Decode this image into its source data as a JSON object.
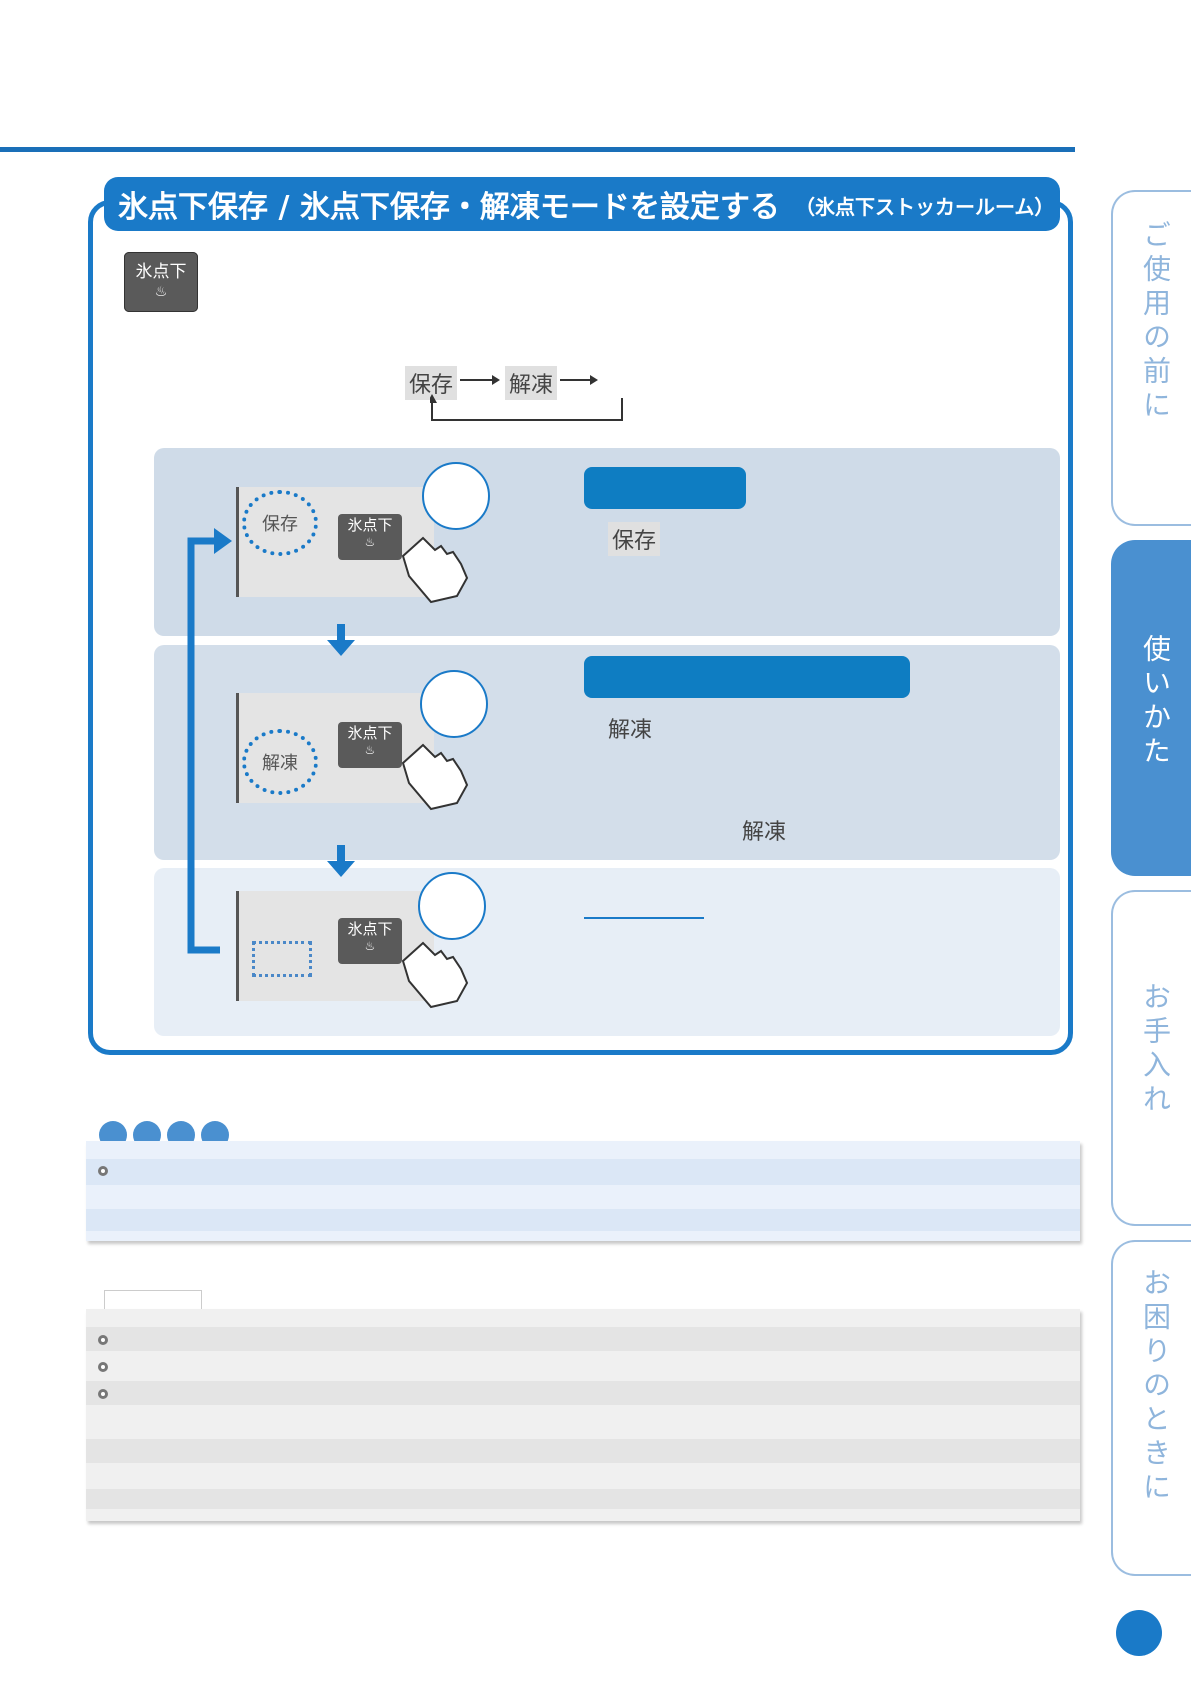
{
  "title": {
    "main": "氷点下保存 / 氷点下保存・解凍モードを設定する",
    "sub": "（氷点下ストッカールーム）"
  },
  "button": {
    "label": "氷点下",
    "fish_glyph": "♨"
  },
  "cycle": {
    "save": "保存",
    "thaw": "解凍",
    "arrow": "→"
  },
  "steps": [
    {
      "ring_label": "保存",
      "desc_label": "保存"
    },
    {
      "ring_label": "解凍",
      "desc_label": "解凍",
      "desc_label_2": "解凍"
    },
    {
      "ring_label": ""
    }
  ],
  "side_tabs": [
    {
      "label": "ご使用の前に",
      "active": false
    },
    {
      "label": "使いかた",
      "active": true
    },
    {
      "label": "お手入れ",
      "active": false
    },
    {
      "label": "お困りのときに",
      "active": false
    }
  ],
  "colors": {
    "accent": "#1a7ac8",
    "pill": "#0e7dc2",
    "tab_active": "#4a90d0"
  }
}
